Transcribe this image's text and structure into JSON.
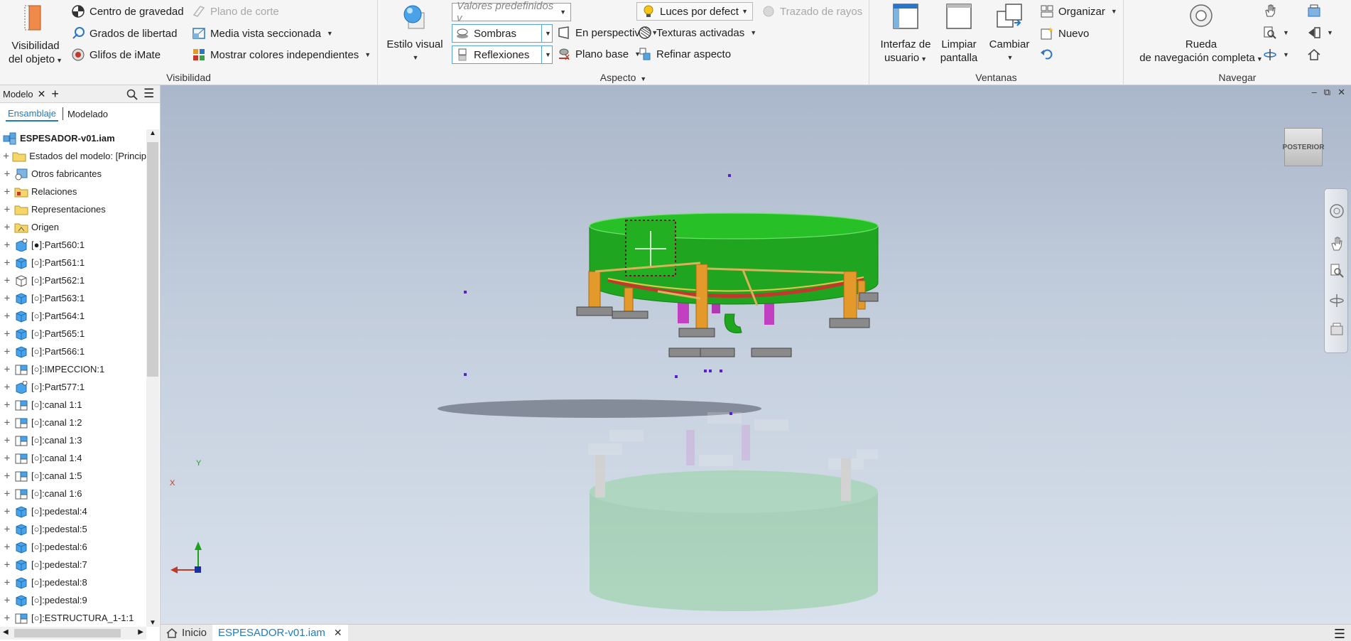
{
  "ribbon": {
    "visibilidad": {
      "title": "Visibilidad",
      "big_label_1": "Visibilidad",
      "big_label_2": "del objeto",
      "centro_gravedad": "Centro de gravedad",
      "grados_libertad": "Grados de libertad",
      "glifos_imate": "Glifos de iMate",
      "plano_corte": "Plano de corte",
      "media_vista": "Media vista seccionada",
      "mostrar_colores": "Mostrar colores independientes"
    },
    "aspecto": {
      "title": "Aspecto",
      "estilo_visual": "Estilo visual",
      "valores_predefinidos": "Valores predefinidos v",
      "sombras": "Sombras",
      "reflexiones": "Reflexiones",
      "en_perspectiva": "En perspectiva",
      "plano_base": "Plano base",
      "luces": "Luces por defect",
      "texturas": "Texturas activadas",
      "refinar": "Refinar aspecto",
      "trazado_rayos": "Trazado de rayos"
    },
    "ventanas": {
      "title": "Ventanas",
      "interfaz_1": "Interfaz de",
      "interfaz_2": "usuario",
      "limpiar_1": "Limpiar",
      "limpiar_2": "pantalla",
      "cambiar": "Cambiar",
      "organizar": "Organizar",
      "nuevo": "Nuevo"
    },
    "navegar": {
      "title": "Navegar",
      "rueda_1": "Rueda",
      "rueda_2": "de navegación completa"
    }
  },
  "browser": {
    "tab_label": "Modelo",
    "subtab_active": "Ensamblaje",
    "subtab_other": "Modelado",
    "tree": [
      {
        "label": "ESPESADOR-v01.iam",
        "icon": "assembly-icon",
        "root": true
      },
      {
        "label": "Estados del modelo: [Princip",
        "icon": "folder-icon"
      },
      {
        "label": "Otros fabricantes",
        "icon": "third-party-icon"
      },
      {
        "label": "Relaciones",
        "icon": "relations-icon"
      },
      {
        "label": "Representaciones",
        "icon": "folder-icon"
      },
      {
        "label": "Origen",
        "icon": "origin-folder-icon"
      },
      {
        "label": "[●]:Part560:1",
        "icon": "part-pin-icon"
      },
      {
        "label": "[○]:Part561:1",
        "icon": "part-icon"
      },
      {
        "label": "[○]:Part562:1",
        "icon": "part-wire-icon"
      },
      {
        "label": "[○]:Part563:1",
        "icon": "part-icon"
      },
      {
        "label": "[○]:Part564:1",
        "icon": "part-icon"
      },
      {
        "label": "[○]:Part565:1",
        "icon": "part-icon"
      },
      {
        "label": "[○]:Part566:1",
        "icon": "part-icon"
      },
      {
        "label": "[○]:IMPECCION:1",
        "icon": "subassembly-icon"
      },
      {
        "label": "[○]:Part577:1",
        "icon": "part-pin-icon"
      },
      {
        "label": "[○]:canal 1:1",
        "icon": "subassembly-icon"
      },
      {
        "label": "[○]:canal 1:2",
        "icon": "subassembly-icon"
      },
      {
        "label": "[○]:canal 1:3",
        "icon": "subassembly-icon"
      },
      {
        "label": "[○]:canal 1:4",
        "icon": "subassembly-icon"
      },
      {
        "label": "[○]:canal 1:5",
        "icon": "subassembly-icon"
      },
      {
        "label": "[○]:canal 1:6",
        "icon": "subassembly-icon"
      },
      {
        "label": "[○]:pedestal:4",
        "icon": "part-icon"
      },
      {
        "label": "[○]:pedestal:5",
        "icon": "part-icon"
      },
      {
        "label": "[○]:pedestal:6",
        "icon": "part-icon"
      },
      {
        "label": "[○]:pedestal:7",
        "icon": "part-icon"
      },
      {
        "label": "[○]:pedestal:8",
        "icon": "part-icon"
      },
      {
        "label": "[○]:pedestal:9",
        "icon": "part-icon"
      },
      {
        "label": "[○]:ESTRUCTURA_1-1:1",
        "icon": "subassembly-icon"
      }
    ]
  },
  "viewport": {
    "viewcube_label": "POSTERIOR",
    "axis_x": "X",
    "axis_y": "Y"
  },
  "doctabs": {
    "home": "Inicio",
    "active": "ESPESADOR-v01.iam"
  },
  "colors": {
    "accent": "#1f7bc1",
    "tank_green": "#1fb01f",
    "leg_orange": "#e39a2a",
    "pink_pipe": "#c23fc2",
    "base_gray": "#8a8a8a"
  }
}
